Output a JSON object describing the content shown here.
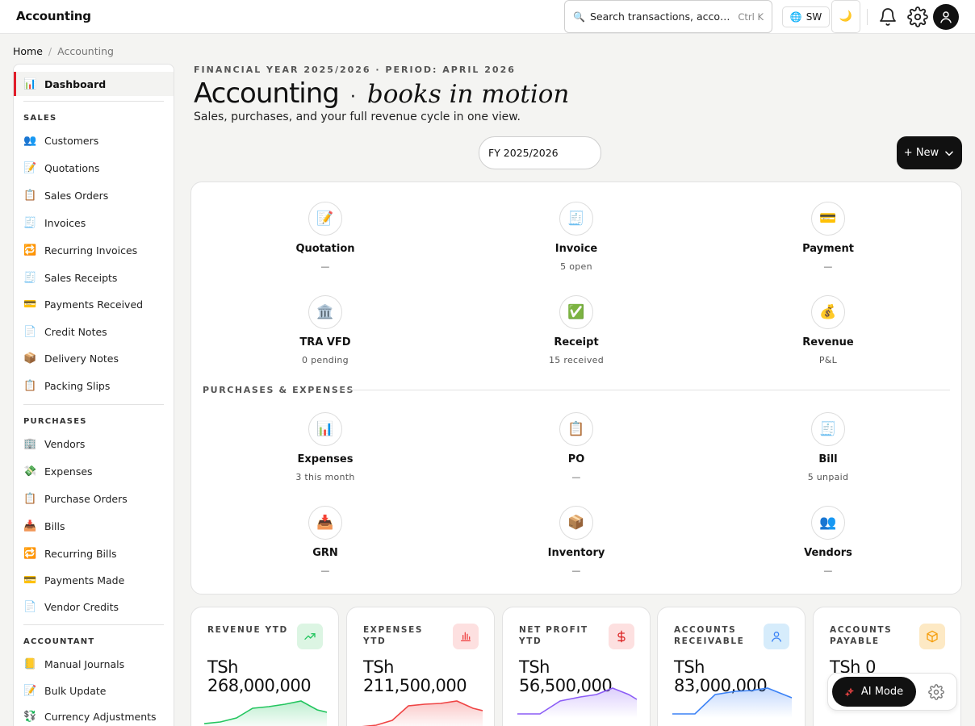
{
  "header": {
    "app_title": "Accounting",
    "search_placeholder": "Search transactions, accounts…",
    "search_shortcut": "Ctrl K",
    "language": "SW"
  },
  "breadcrumb": {
    "home": "Home",
    "current": "Accounting"
  },
  "sidebar": {
    "dashboard": "Dashboard",
    "sections": [
      {
        "title": "SALES",
        "items": [
          "Customers",
          "Quotations",
          "Sales Orders",
          "Invoices",
          "Recurring Invoices",
          "Sales Receipts",
          "Payments Received",
          "Credit Notes",
          "Delivery Notes",
          "Packing Slips"
        ]
      },
      {
        "title": "PURCHASES",
        "items": [
          "Vendors",
          "Expenses",
          "Purchase Orders",
          "Bills",
          "Recurring Bills",
          "Payments Made",
          "Vendor Credits"
        ]
      },
      {
        "title": "ACCOUNTANT",
        "items": [
          "Manual Journals",
          "Bulk Update",
          "Currency Adjustments"
        ]
      }
    ]
  },
  "page": {
    "eyebrow": "FINANCIAL YEAR 2025/2026 · PERIOD: APRIL 2026",
    "title": "Accounting",
    "title_italic": "books in motion",
    "subtitle": "Sales, purchases, and your full revenue cycle in one view.",
    "fy_select": "FY 2025/2026",
    "new_button": "+ New"
  },
  "flow": {
    "sales_nodes": [
      {
        "name": "Quotation",
        "status": "—"
      },
      {
        "name": "Invoice",
        "status": "5 open"
      },
      {
        "name": "Payment",
        "status": "—"
      },
      {
        "name": "TRA VFD",
        "status": "0 pending"
      },
      {
        "name": "Receipt",
        "status": "15 received"
      },
      {
        "name": "Revenue",
        "status": "P&L"
      }
    ],
    "purchases_label": "PURCHASES & EXPENSES",
    "purchase_nodes": [
      {
        "name": "Expenses",
        "status": "3 this month"
      },
      {
        "name": "PO",
        "status": "—"
      },
      {
        "name": "Bill",
        "status": "5 unpaid"
      },
      {
        "name": "GRN",
        "status": "—"
      },
      {
        "name": "Inventory",
        "status": "—"
      },
      {
        "name": "Vendors",
        "status": "—"
      }
    ]
  },
  "kpis": [
    {
      "label": "REVENUE YTD",
      "value": "TSh 268,000,000",
      "color": "#22c55e",
      "badge_bg": "#dcf5e3"
    },
    {
      "label": "EXPENSES YTD",
      "value": "TSh 211,500,000",
      "color": "#ef4444",
      "badge_bg": "#fde0e0"
    },
    {
      "label": "NET PROFIT YTD",
      "value": "TSh 56,500,000",
      "color": "#8b5cf6",
      "badge_bg": "#fde0e0"
    },
    {
      "label": "ACCOUNTS RECEIVABLE",
      "value": "TSh 83,000,000",
      "color": "#3b82f6",
      "badge_bg": "#d6ecfb"
    },
    {
      "label": "ACCOUNTS PAYABLE",
      "value": "TSh 0",
      "color": "#f59e0b",
      "badge_bg": "#fde9c4"
    }
  ],
  "ai": {
    "label": "AI Mode"
  }
}
